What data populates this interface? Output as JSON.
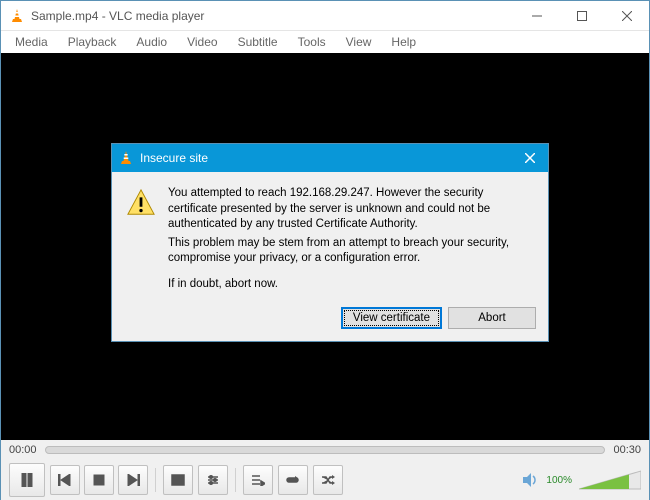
{
  "window": {
    "title": "Sample.mp4 - VLC media player"
  },
  "menu": {
    "items": [
      "Media",
      "Playback",
      "Audio",
      "Video",
      "Subtitle",
      "Tools",
      "View",
      "Help"
    ]
  },
  "seek": {
    "current": "00:00",
    "total": "00:30"
  },
  "volume": {
    "label": "100%"
  },
  "dialog": {
    "title": "Insecure site",
    "p1": "You attempted to reach 192.168.29.247. However the security certificate presented by the server is unknown and could not be authenticated by any trusted Certificate Authority.",
    "p2": "This problem may be stem from an attempt to breach your security, compromise your privacy, or a configuration error.",
    "p3": "If in doubt, abort now.",
    "view_btn": "View certificate",
    "abort_btn": "Abort"
  }
}
